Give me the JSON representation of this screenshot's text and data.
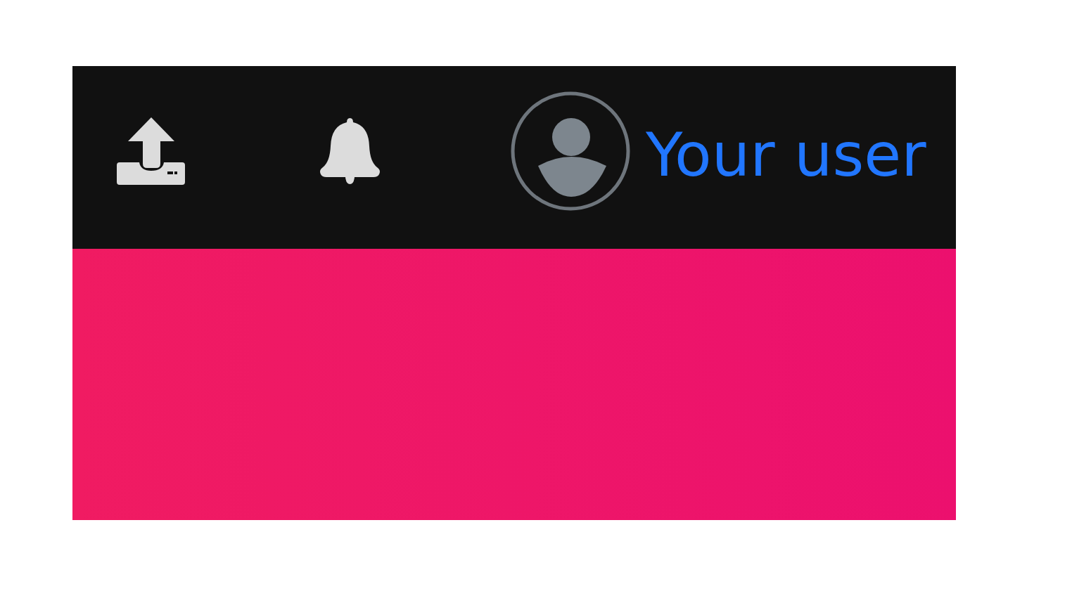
{
  "header": {
    "user_link": {
      "label": "Your user"
    }
  }
}
